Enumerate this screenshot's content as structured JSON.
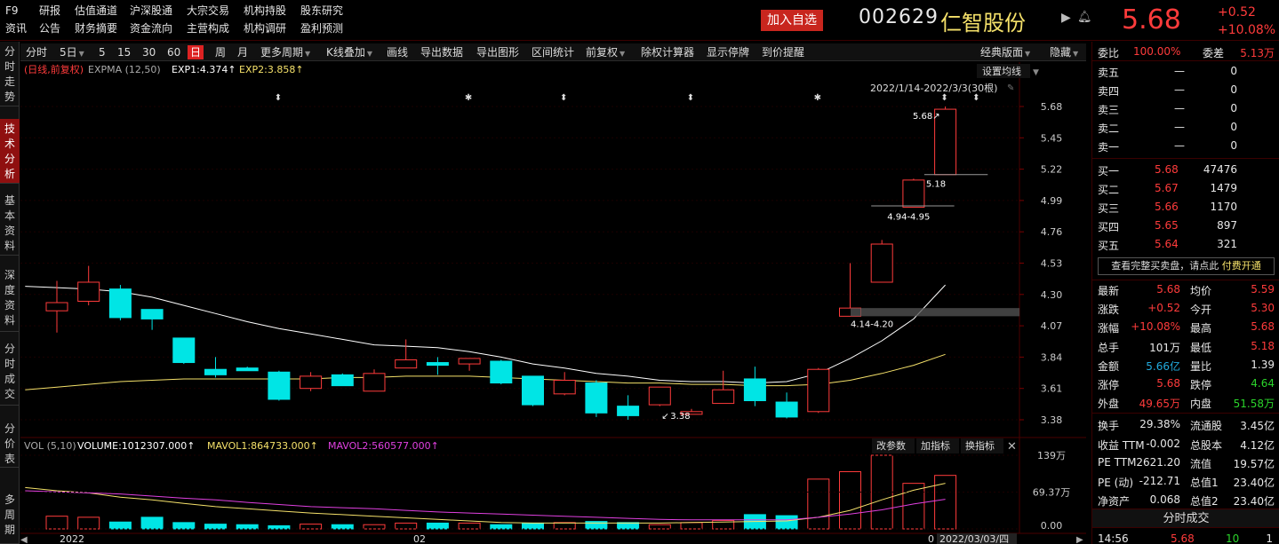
{
  "header": {
    "code_label": "F9",
    "nav_row1": [
      "研报",
      "估值通道",
      "沪深股通",
      "大宗交易",
      "机构持股",
      "股东研究"
    ],
    "nav_row2": [
      "资讯",
      "公告",
      "财务摘要",
      "资金流向",
      "主营构成",
      "机构调研",
      "盈利预测"
    ],
    "add_watch": "加入自选",
    "stock_code": "002629",
    "stock_name": "仁智股份",
    "price": "5.68",
    "change": "+0.52",
    "change_pct": "+10.08%",
    "colors": {
      "up": "#ff3b3b",
      "down": "#2bd42b",
      "accent": "#c8261e"
    }
  },
  "sidebar_tabs": [
    "分时走势",
    "技术分析",
    "基本资料",
    "深度资料",
    "分时成交",
    "分价表",
    "多周期"
  ],
  "toolbar": {
    "items": [
      "分时",
      "5日",
      "5",
      "15",
      "30",
      "60",
      "日",
      "周",
      "月",
      "更多周期",
      "K线叠加",
      "画线",
      "导出数据",
      "导出图形",
      "区间统计",
      "前复权",
      "除权计算器",
      "显示停牌",
      "到价提醒"
    ],
    "selected": "日",
    "layout_select": "经典版面",
    "hide": "隐藏"
  },
  "chart_labels": {
    "adj": "(日线,前复权)",
    "expma_name": "EXPMA (12,50)",
    "exp1": "EXP1:4.374↑",
    "exp2": "EXP2:3.858↑",
    "set_ma": "设置均线",
    "range": "2022/1/14-2022/3/3(30根)",
    "ann_high": "5.68↗",
    "ann_518": "5.18",
    "ann_494": "4.94-4.95",
    "ann_414": "4.14-4.20",
    "ann_338": "3.38",
    "price_ticks": [
      "5.68",
      "5.45",
      "5.22",
      "4.99",
      "4.76",
      "4.53",
      "4.30",
      "4.07",
      "3.84",
      "3.61",
      "3.38"
    ],
    "vol_name": "VOL (5,10)",
    "vol_value": "VOLUME:1012307.000↑",
    "mavol1": "MAVOL1:864733.000↑",
    "mavol2": "MAVOL2:560577.000↑",
    "vol_btns": [
      "改参数",
      "加指标",
      "换指标"
    ],
    "vol_ticks": [
      "139万",
      "69.37万",
      "0.00"
    ],
    "x_labels": [
      "2022",
      "02",
      "0",
      "2022/03/03/四"
    ]
  },
  "chart_data": {
    "type": "candlestick",
    "dates_range": "2022/1/14-2022/3/3",
    "candles": [
      {
        "o": 4.18,
        "h": 4.4,
        "l": 4.02,
        "c": 4.24
      },
      {
        "o": 4.25,
        "h": 4.51,
        "l": 4.22,
        "c": 4.39
      },
      {
        "o": 4.34,
        "h": 4.37,
        "l": 4.11,
        "c": 4.13
      },
      {
        "o": 4.19,
        "h": 4.19,
        "l": 4.04,
        "c": 4.12
      },
      {
        "o": 3.98,
        "h": 3.98,
        "l": 3.79,
        "c": 3.8
      },
      {
        "o": 3.75,
        "h": 3.84,
        "l": 3.69,
        "c": 3.71
      },
      {
        "o": 3.76,
        "h": 3.77,
        "l": 3.74,
        "c": 3.74
      },
      {
        "o": 3.73,
        "h": 3.74,
        "l": 3.52,
        "c": 3.53
      },
      {
        "o": 3.61,
        "h": 3.73,
        "l": 3.59,
        "c": 3.7
      },
      {
        "o": 3.71,
        "h": 3.72,
        "l": 3.63,
        "c": 3.63
      },
      {
        "o": 3.59,
        "h": 3.75,
        "l": 3.59,
        "c": 3.72
      },
      {
        "o": 3.76,
        "h": 3.97,
        "l": 3.76,
        "c": 3.82
      },
      {
        "o": 3.8,
        "h": 3.84,
        "l": 3.71,
        "c": 3.78
      },
      {
        "o": 3.79,
        "h": 3.83,
        "l": 3.74,
        "c": 3.83
      },
      {
        "o": 3.81,
        "h": 3.82,
        "l": 3.64,
        "c": 3.65
      },
      {
        "o": 3.7,
        "h": 3.7,
        "l": 3.48,
        "c": 3.49
      },
      {
        "o": 3.57,
        "h": 3.73,
        "l": 3.56,
        "c": 3.67
      },
      {
        "o": 3.65,
        "h": 3.67,
        "l": 3.4,
        "c": 3.43
      },
      {
        "o": 3.48,
        "h": 3.56,
        "l": 3.38,
        "c": 3.41
      },
      {
        "o": 3.49,
        "h": 3.62,
        "l": 3.48,
        "c": 3.62
      },
      {
        "o": 3.42,
        "h": 3.46,
        "l": 3.42,
        "c": 3.44
      },
      {
        "o": 3.5,
        "h": 3.74,
        "l": 3.5,
        "c": 3.6
      },
      {
        "o": 3.68,
        "h": 3.77,
        "l": 3.48,
        "c": 3.52
      },
      {
        "o": 3.51,
        "h": 3.58,
        "l": 3.39,
        "c": 3.4
      },
      {
        "o": 3.44,
        "h": 3.76,
        "l": 3.43,
        "c": 3.75
      },
      {
        "o": 4.14,
        "h": 4.53,
        "l": 4.14,
        "c": 4.2
      },
      {
        "o": 4.39,
        "h": 4.7,
        "l": 4.39,
        "c": 4.67
      },
      {
        "o": 4.94,
        "h": 5.15,
        "l": 4.94,
        "c": 5.14
      },
      {
        "o": 5.18,
        "h": 5.68,
        "l": 5.18,
        "c": 5.66
      }
    ],
    "ema12": [
      4.36,
      4.35,
      4.34,
      4.32,
      4.28,
      4.22,
      4.16,
      4.1,
      4.05,
      4.01,
      3.97,
      3.93,
      3.92,
      3.91,
      3.88,
      3.84,
      3.79,
      3.76,
      3.72,
      3.7,
      3.67,
      3.66,
      3.66,
      3.65,
      3.66,
      3.72,
      3.83,
      3.96,
      4.12,
      4.37
    ],
    "ema50": [
      3.6,
      3.62,
      3.64,
      3.66,
      3.67,
      3.68,
      3.68,
      3.68,
      3.68,
      3.68,
      3.69,
      3.69,
      3.7,
      3.7,
      3.7,
      3.69,
      3.68,
      3.67,
      3.66,
      3.65,
      3.65,
      3.64,
      3.64,
      3.63,
      3.63,
      3.64,
      3.67,
      3.72,
      3.78,
      3.86
    ],
    "volume": [
      28,
      24,
      22,
      13,
      22,
      12,
      9,
      8,
      6,
      9,
      8,
      8,
      11,
      11,
      11,
      8,
      11,
      12,
      14,
      12,
      8,
      12,
      16,
      27,
      25,
      94,
      108,
      139,
      86,
      101
    ],
    "mavol1": [
      78,
      72,
      68,
      60,
      55,
      48,
      42,
      38,
      34,
      30,
      27,
      24,
      21,
      18,
      15,
      12,
      11,
      11,
      11,
      11,
      11,
      12,
      13,
      14,
      15,
      22,
      35,
      55,
      73,
      86
    ],
    "mavol2": [
      72,
      70,
      68,
      66,
      62,
      58,
      55,
      50,
      46,
      42,
      40,
      38,
      35,
      32,
      30,
      28,
      26,
      24,
      22,
      20,
      18,
      17,
      17,
      17,
      17,
      22,
      28,
      36,
      47,
      56
    ],
    "price_axis": [
      3.38,
      5.68
    ],
    "vol_axis": [
      0,
      139
    ]
  },
  "order_book": {
    "ratio_label": "委比",
    "ratio_val": "100.00%",
    "diff_label": "委差",
    "diff_val": "5.13万",
    "asks": [
      {
        "l": "卖五",
        "p": "—",
        "v": "0"
      },
      {
        "l": "卖四",
        "p": "—",
        "v": "0"
      },
      {
        "l": "卖三",
        "p": "—",
        "v": "0"
      },
      {
        "l": "卖二",
        "p": "—",
        "v": "0"
      },
      {
        "l": "卖一",
        "p": "—",
        "v": "0"
      }
    ],
    "bids": [
      {
        "l": "买一",
        "p": "5.68",
        "v": "47476"
      },
      {
        "l": "买二",
        "p": "5.67",
        "v": "1479"
      },
      {
        "l": "买三",
        "p": "5.66",
        "v": "1170"
      },
      {
        "l": "买四",
        "p": "5.65",
        "v": "897"
      },
      {
        "l": "买五",
        "p": "5.64",
        "v": "321"
      }
    ],
    "cta_text": "查看完整买卖盘，请点此 ",
    "cta_link": "付费开通"
  },
  "quote": [
    {
      "k1": "最新",
      "v1": "5.68",
      "c1": "r",
      "k2": "均价",
      "v2": "5.59",
      "c2": "r"
    },
    {
      "k1": "涨跌",
      "v1": "+0.52",
      "c1": "r",
      "k2": "今开",
      "v2": "5.30",
      "c2": "r"
    },
    {
      "k1": "涨幅",
      "v1": "+10.08%",
      "c1": "r",
      "k2": "最高",
      "v2": "5.68",
      "c2": "r"
    },
    {
      "k1": "总手",
      "v1": "101万",
      "c1": "w",
      "k2": "最低",
      "v2": "5.18",
      "c2": "r"
    },
    {
      "k1": "金额",
      "v1": "5.66亿",
      "c1": "c",
      "k2": "量比",
      "v2": "1.39",
      "c2": "w"
    },
    {
      "k1": "涨停",
      "v1": "5.68",
      "c1": "r",
      "k2": "跌停",
      "v2": "4.64",
      "c2": "g"
    },
    {
      "k1": "外盘",
      "v1": "49.65万",
      "c1": "r",
      "k2": "内盘",
      "v2": "51.58万",
      "c2": "g"
    },
    {
      "k1": "换手",
      "v1": "29.38%",
      "c1": "w",
      "k2": "流通股",
      "v2": "3.45亿",
      "c2": "w"
    },
    {
      "k1": "收益 TTM",
      "v1": "-0.002",
      "c1": "w",
      "k2": "总股本",
      "v2": "4.12亿",
      "c2": "w"
    },
    {
      "k1": "PE TTM",
      "v1": "2621.20",
      "c1": "w",
      "k2": "流值",
      "v2": "19.57亿",
      "c2": "w"
    },
    {
      "k1": "PE (动)",
      "v1": "-212.71",
      "c1": "w",
      "k2": "总值1",
      "v2": "23.40亿",
      "c2": "w"
    },
    {
      "k1": "净资产",
      "v1": "0.068",
      "c1": "w",
      "k2": "总值2",
      "v2": "23.40亿",
      "c2": "w"
    }
  ],
  "ticks_section": {
    "title": "分时成交",
    "row": {
      "time": "14:56",
      "price": "5.68",
      "vol": "10",
      "n": "1"
    }
  }
}
